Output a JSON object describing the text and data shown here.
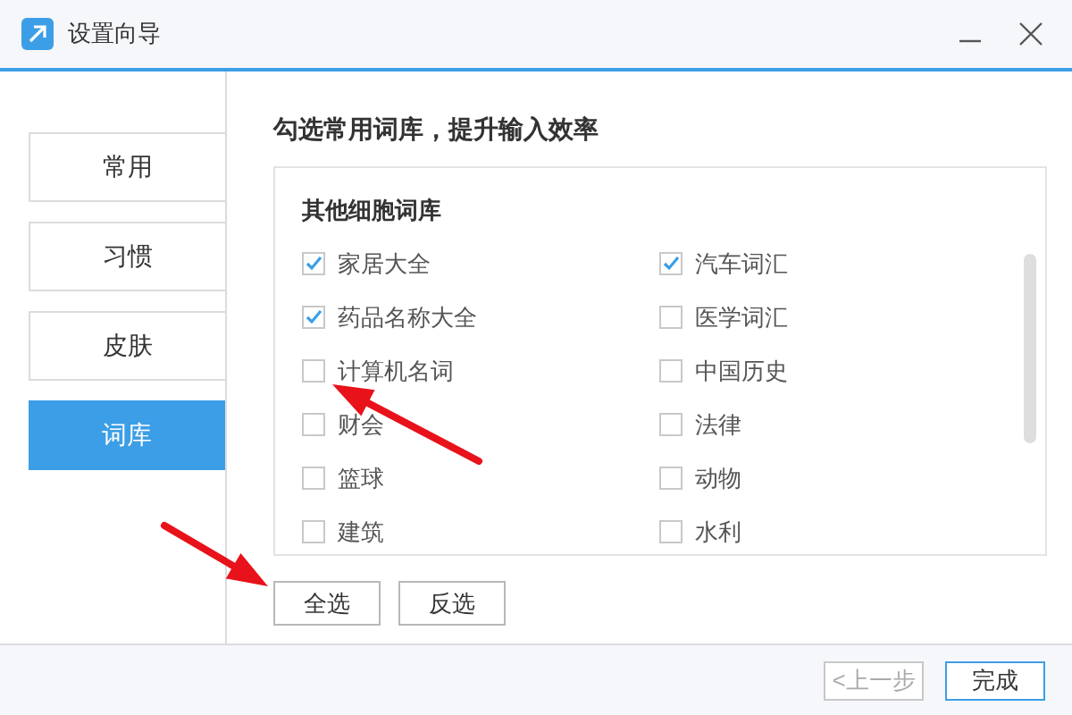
{
  "window": {
    "title": "设置向导"
  },
  "sidebar": {
    "items": [
      {
        "label": "常用",
        "selected": false
      },
      {
        "label": "习惯",
        "selected": false
      },
      {
        "label": "皮肤",
        "selected": false
      },
      {
        "label": "词库",
        "selected": true
      }
    ]
  },
  "heading": "勾选常用词库，提升输入效率",
  "group": {
    "title": "其他细胞词库",
    "items": [
      {
        "label": "家居大全",
        "checked": true
      },
      {
        "label": "汽车词汇",
        "checked": true
      },
      {
        "label": "药品名称大全",
        "checked": true
      },
      {
        "label": "医学词汇",
        "checked": false
      },
      {
        "label": "计算机名词",
        "checked": false
      },
      {
        "label": "中国历史",
        "checked": false
      },
      {
        "label": "财会",
        "checked": false
      },
      {
        "label": "法律",
        "checked": false
      },
      {
        "label": "篮球",
        "checked": false
      },
      {
        "label": "动物",
        "checked": false
      },
      {
        "label": "建筑",
        "checked": false
      },
      {
        "label": "水利",
        "checked": false
      }
    ]
  },
  "actions": [
    "全选",
    "反选"
  ],
  "footer": {
    "buttons": [
      {
        "label": "<上一步",
        "disabled": true
      },
      {
        "label": "完成",
        "disabled": false
      }
    ]
  }
}
